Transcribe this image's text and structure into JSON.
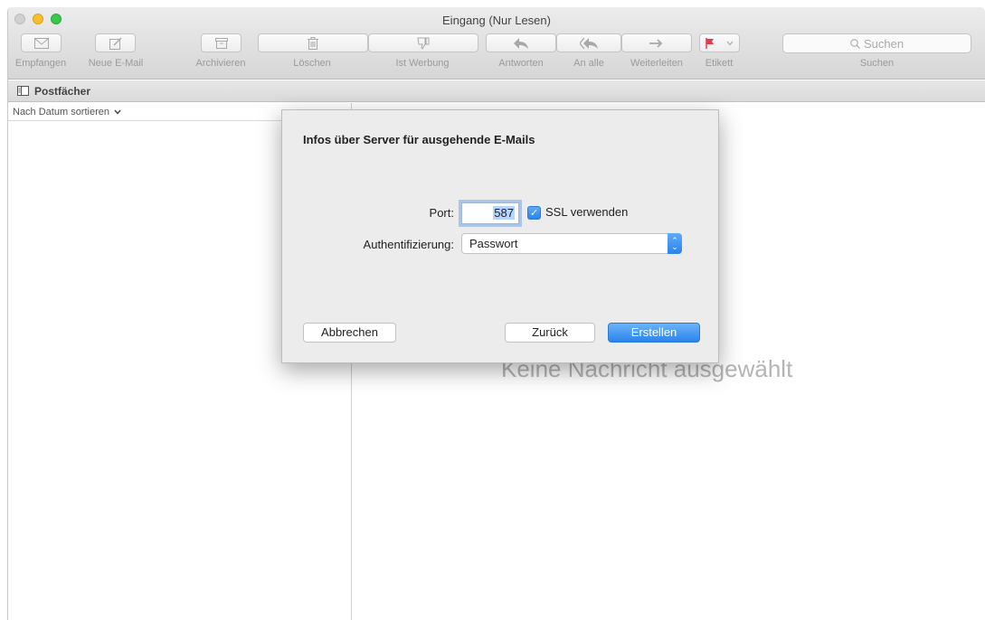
{
  "window": {
    "title": "Eingang (Nur Lesen)"
  },
  "toolbar": {
    "get_mail": "Empfangen",
    "new_mail": "Neue E-Mail",
    "archive": "Archivieren",
    "delete": "Löschen",
    "junk": "Ist Werbung",
    "reply": "Antworten",
    "reply_all": "An alle",
    "forward": "Weiterleiten",
    "flag": "Etikett",
    "search_placeholder": "Suchen",
    "search_label": "Suchen"
  },
  "mailboxbar": {
    "label": "Postfächer"
  },
  "list": {
    "sort_label": "Nach Datum sortieren"
  },
  "content": {
    "empty_message": "Keine Nachricht ausgewählt"
  },
  "dialog": {
    "title": "Infos über Server für ausgehende E-Mails",
    "port_label": "Port:",
    "port_value": "587",
    "ssl_label": "SSL verwenden",
    "ssl_checked": true,
    "auth_label": "Authentifizierung:",
    "auth_value": "Passwort",
    "cancel_label": "Abbrechen",
    "back_label": "Zurück",
    "create_label": "Erstellen"
  },
  "colors": {
    "accent": "#2a84ed",
    "flag": "#e8384f"
  }
}
